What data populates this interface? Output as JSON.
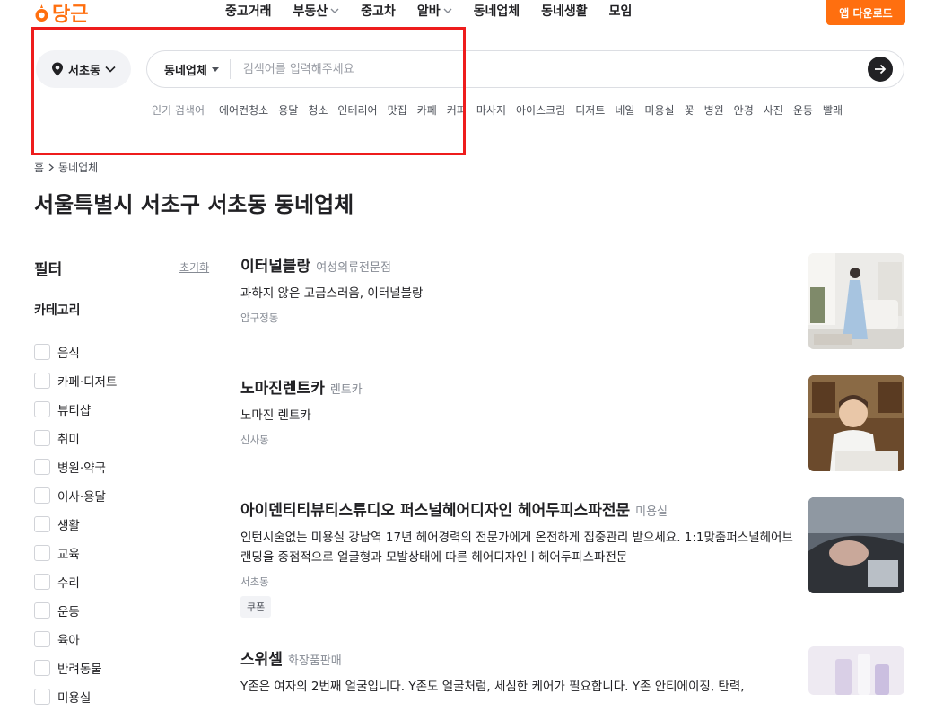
{
  "header": {
    "logo_text": "당근",
    "nav": [
      {
        "label": "중고거래",
        "dropdown": false
      },
      {
        "label": "부동산",
        "dropdown": true
      },
      {
        "label": "중고차",
        "dropdown": false
      },
      {
        "label": "알바",
        "dropdown": true
      },
      {
        "label": "동네업체",
        "dropdown": false
      },
      {
        "label": "동네생활",
        "dropdown": false
      },
      {
        "label": "모임",
        "dropdown": false
      }
    ],
    "app_download": "앱 다운로드",
    "brand_color": "#ff6f0f"
  },
  "location": {
    "label": "서초동"
  },
  "search": {
    "category": "동네업체",
    "placeholder": "검색어를 입력해주세요"
  },
  "popular": {
    "label": "인기 검색어",
    "keywords": [
      "에어컨청소",
      "용달",
      "청소",
      "인테리어",
      "맛집",
      "카페",
      "커피",
      "마사지",
      "아이스크림",
      "디저트",
      "네일",
      "미용실",
      "꽃",
      "병원",
      "안경",
      "사진",
      "운동",
      "빨래"
    ]
  },
  "breadcrumb": {
    "home": "홈",
    "current": "동네업체"
  },
  "page_title": "서울특별시 서초구 서초동 동네업체",
  "filter": {
    "title": "필터",
    "reset": "초기화",
    "category_title": "카테고리",
    "categories": [
      "음식",
      "카페·디저트",
      "뷰티샵",
      "취미",
      "병원·약국",
      "이사·용달",
      "생활",
      "교육",
      "수리",
      "운동",
      "육아",
      "반려동물",
      "미용실"
    ]
  },
  "listings": [
    {
      "name": "이터널블랑",
      "category": "여성의류전문점",
      "desc": "과하지 않은 고급스러움, 이터널블랑",
      "area": "압구정동",
      "badge": ""
    },
    {
      "name": "노마진렌트카",
      "category": "렌트카",
      "desc": "노마진 렌트카",
      "area": "신사동",
      "badge": ""
    },
    {
      "name": "아이덴티티뷰티스튜디오 퍼스널헤어디자인 헤어두피스파전문",
      "category": "미용실",
      "desc": "인턴시술없는 미용실 강남역 17년 헤어경력의 전문가에게 온전하게 집중관리 받으세요. 1:1맞춤퍼스널헤어브랜딩을 중점적으로 얼굴형과 모발상태에 따른 헤어디자인ㅣ헤어두피스파전문",
      "area": "서초동",
      "badge": "쿠폰"
    },
    {
      "name": "스위셀",
      "category": "화장품판매",
      "desc": "Y존은 여자의 2번째 얼굴입니다. Y존도 얼굴처럼, 세심한 케어가 필요합니다. Y존 안티에이징, 탄력,",
      "area": "",
      "badge": ""
    }
  ]
}
